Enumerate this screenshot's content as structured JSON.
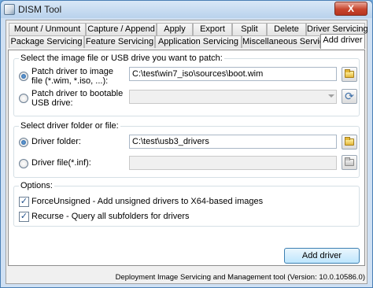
{
  "window": {
    "title": "DISM Tool",
    "close_label": "X"
  },
  "tabs_row1": [
    {
      "label": "Mount / Unmount"
    },
    {
      "label": "Capture / Append"
    },
    {
      "label": "Apply"
    },
    {
      "label": "Export"
    },
    {
      "label": "Split"
    },
    {
      "label": "Delete"
    },
    {
      "label": "Driver Servicing"
    }
  ],
  "tabs_row2": [
    {
      "label": "Package Servicing"
    },
    {
      "label": "Feature Servicing"
    },
    {
      "label": "Application Servicing"
    },
    {
      "label": "Miscellaneous Servicing"
    },
    {
      "label": "Add driver"
    }
  ],
  "active_tab": "Add driver",
  "image_group": {
    "label": "Select the image file or USB drive you want to patch:",
    "patch_image_label": "Patch driver to image file (*.wim, *.iso, ...):",
    "patch_image_value": "C:\\test\\win7_iso\\sources\\boot.wim",
    "patch_usb_label": "Patch driver to bootable USB drive:",
    "patch_usb_value": ""
  },
  "driver_group": {
    "label": "Select driver folder or file:",
    "folder_label": "Driver folder:",
    "folder_value": "C:\\test\\usb3_drivers",
    "file_label": "Driver file(*.inf):",
    "file_value": ""
  },
  "options_group": {
    "label": "Options:",
    "force_unsigned_label": "ForceUnsigned - Add unsigned drivers to X64-based images",
    "force_unsigned_checked": true,
    "recurse_label": "Recurse - Query all subfolders for drivers",
    "recurse_checked": true
  },
  "add_driver_button": "Add driver",
  "status_text": "Deployment Image Servicing and Management tool (Version: 10.0.10586.0)",
  "icons": [
    "app-icon",
    "folder-icon",
    "refresh-icon"
  ]
}
